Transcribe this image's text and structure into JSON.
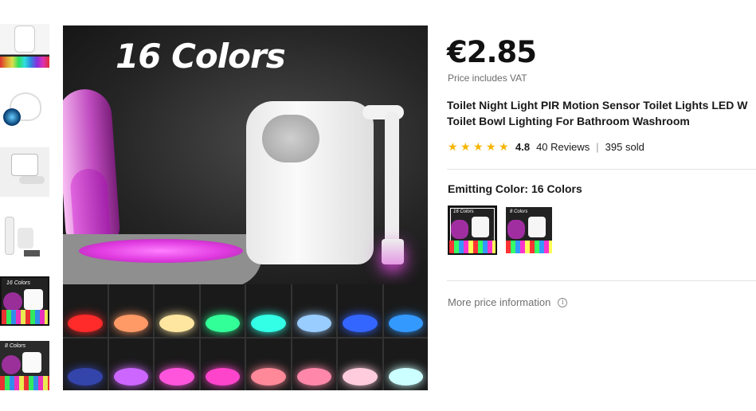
{
  "thumbnails": [
    {
      "name": "thumb-1",
      "label": ""
    },
    {
      "name": "thumb-2",
      "label": ""
    },
    {
      "name": "thumb-3",
      "label": ""
    },
    {
      "name": "thumb-4",
      "label": ""
    },
    {
      "name": "thumb-5",
      "label": "16 Colors"
    },
    {
      "name": "thumb-6",
      "label": "8 Colors"
    }
  ],
  "main_image": {
    "overlay_text": "16 Colors",
    "color_cells": [
      "#ff2a2a",
      "#ff9966",
      "#ffe6a0",
      "#33ff99",
      "#33ffe6",
      "#99ccff",
      "#3366ff",
      "#3399ff",
      "#3344aa",
      "#cc66ff",
      "#ff55dd",
      "#ff44cc",
      "#ff8899",
      "#ff88aa",
      "#ffccdd",
      "#ccffff"
    ]
  },
  "product": {
    "price": "€2.85",
    "vat_note": "Price includes VAT",
    "title_line1": "Toilet Night Light PIR Motion Sensor Toilet Lights LED W",
    "title_line2": "Toilet Bowl Lighting For Bathroom Washroom",
    "rating": "4.8",
    "stars": 5,
    "reviews": "40 Reviews",
    "separator": "|",
    "sold": "395 sold"
  },
  "variant": {
    "label": "Emitting Color: 16 Colors",
    "options": [
      {
        "label": "16 Colors",
        "selected": true
      },
      {
        "label": "8 Colors",
        "selected": false
      }
    ]
  },
  "more_price": {
    "label": "More price information",
    "icon": "info-icon"
  },
  "colors": {
    "star": "#f6b500",
    "text": "#191919",
    "muted": "#707070"
  }
}
